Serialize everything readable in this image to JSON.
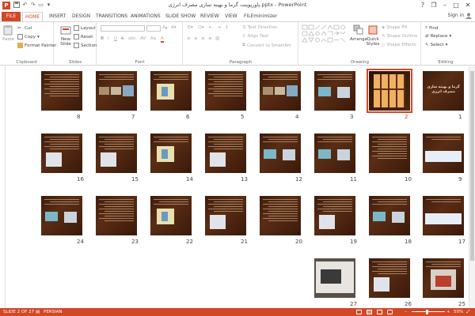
{
  "titlebar": {
    "title": "پاورپوینت گرما و بهینه سازی مصرف انرژی.pptx - PowerPoint",
    "app_icon_letter": "P",
    "help_label": "?",
    "restore_glyph": "❐",
    "minimize_glyph": "–",
    "maximize_glyph": "□",
    "close_glyph": "✕"
  },
  "tabs": [
    "FILE",
    "HOME",
    "INSERT",
    "DESIGN",
    "TRANSITIONS",
    "ANIMATIONS",
    "SLIDE SHOW",
    "REVIEW",
    "VIEW",
    "FILEminimizer"
  ],
  "signin": "Sign in",
  "ribbon": {
    "clipboard": {
      "label": "Clipboard",
      "paste": "Paste",
      "cut": "Cut",
      "copy": "Copy",
      "format_painter": "Format Painter"
    },
    "slides": {
      "label": "Slides",
      "new_slide": "New Slide",
      "layout": "Layout",
      "reset": "Reset",
      "section": "Section"
    },
    "font": {
      "label": "Font",
      "bold": "B",
      "italic": "I",
      "underline": "U",
      "strike": "S",
      "shadow": "abc",
      "spacing": "AV",
      "case": "Aa",
      "color": "A"
    },
    "paragraph": {
      "label": "Paragraph",
      "text_direction": "Text Direction",
      "align_text": "Align Text",
      "smartart": "Convert to SmartArt"
    },
    "drawing": {
      "label": "Drawing",
      "arrange": "Arrange",
      "quick_styles": "Quick Styles",
      "shape_fill": "Shape Fill",
      "shape_outline": "Shape Outline",
      "shape_effects": "Shape Effects"
    },
    "editing": {
      "label": "Editing",
      "find": "Find",
      "replace": "Replace",
      "select": "Select"
    }
  },
  "slides": [
    {
      "num": "1",
      "row": 0,
      "col": 0,
      "kind": "title",
      "title": "گرما و بهینه سازی مصرف انرژی"
    },
    {
      "num": "2",
      "row": 0,
      "col": 1,
      "kind": "window",
      "selected": true
    },
    {
      "num": "3",
      "row": 0,
      "col": 2,
      "kind": "pics2"
    },
    {
      "num": "4",
      "row": 0,
      "col": 3,
      "kind": "pics3"
    },
    {
      "num": "5",
      "row": 0,
      "col": 4,
      "kind": "text"
    },
    {
      "num": "6",
      "row": 0,
      "col": 5,
      "kind": "person"
    },
    {
      "num": "7",
      "row": 0,
      "col": 6,
      "kind": "pics3"
    },
    {
      "num": "8",
      "row": 0,
      "col": 7,
      "kind": "text"
    },
    {
      "num": "9",
      "row": 1,
      "col": 0,
      "kind": "diagram"
    },
    {
      "num": "10",
      "row": 1,
      "col": 1,
      "kind": "text"
    },
    {
      "num": "11",
      "row": 1,
      "col": 2,
      "kind": "pics2"
    },
    {
      "num": "12",
      "row": 1,
      "col": 3,
      "kind": "pics2"
    },
    {
      "num": "13",
      "row": 1,
      "col": 4,
      "kind": "pics1"
    },
    {
      "num": "14",
      "row": 1,
      "col": 5,
      "kind": "person"
    },
    {
      "num": "15",
      "row": 1,
      "col": 6,
      "kind": "pics1"
    },
    {
      "num": "16",
      "row": 1,
      "col": 7,
      "kind": "pics1"
    },
    {
      "num": "17",
      "row": 2,
      "col": 0,
      "kind": "diagram"
    },
    {
      "num": "18",
      "row": 2,
      "col": 1,
      "kind": "pics2"
    },
    {
      "num": "19",
      "row": 2,
      "col": 2,
      "kind": "pics1"
    },
    {
      "num": "20",
      "row": 2,
      "col": 3,
      "kind": "text"
    },
    {
      "num": "21",
      "row": 2,
      "col": 4,
      "kind": "pics1"
    },
    {
      "num": "22",
      "row": 2,
      "col": 5,
      "kind": "person"
    },
    {
      "num": "23",
      "row": 2,
      "col": 6,
      "kind": "text"
    },
    {
      "num": "24",
      "row": 2,
      "col": 7,
      "kind": "pics2"
    },
    {
      "num": "25",
      "row": 3,
      "col": 0,
      "kind": "house"
    },
    {
      "num": "26",
      "row": 3,
      "col": 1,
      "kind": "pics1"
    },
    {
      "num": "27",
      "row": 3,
      "col": 2,
      "kind": "laptop"
    }
  ],
  "status": {
    "slide_info": "SLIDE 2 OF 27",
    "language": "PERSIAN",
    "zoom": "50%",
    "zoom_minus": "–",
    "zoom_plus": "+"
  },
  "colors": {
    "accent": "#d24726",
    "slide_bg": "#3d1c0c"
  }
}
